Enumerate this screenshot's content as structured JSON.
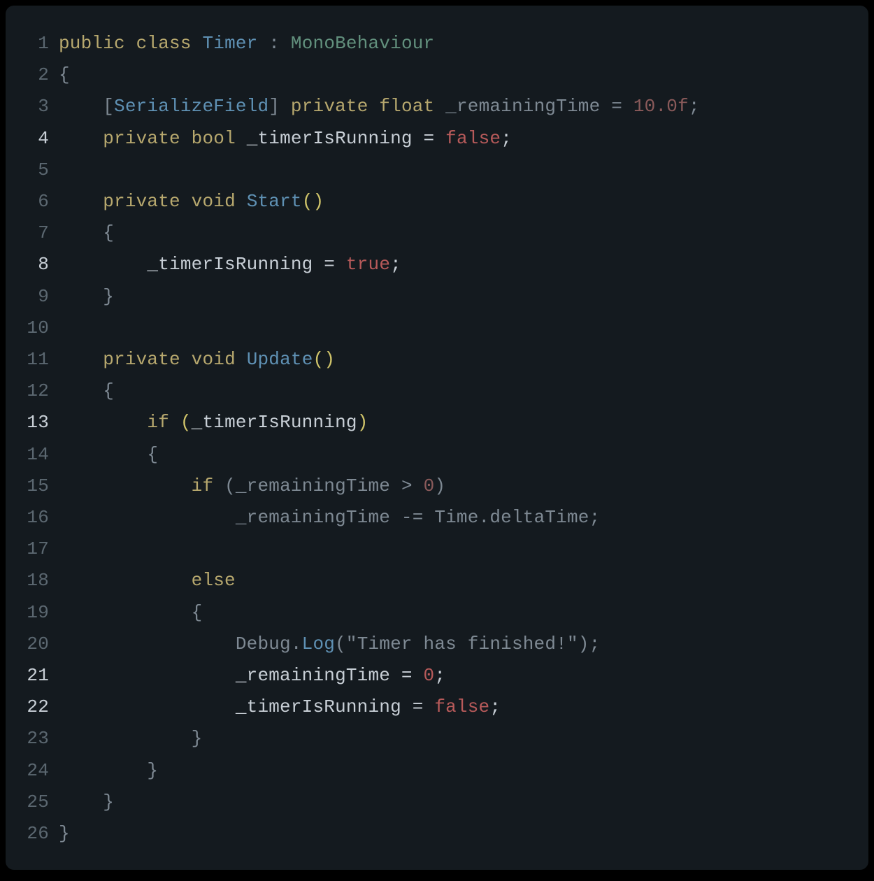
{
  "editor": {
    "lines": [
      {
        "num": "1",
        "bright": false,
        "tokens": [
          {
            "t": "public",
            "c": "tok-keyword"
          },
          {
            "t": " "
          },
          {
            "t": "class",
            "c": "tok-keyword"
          },
          {
            "t": " "
          },
          {
            "t": "Timer",
            "c": "tok-type-blue"
          },
          {
            "t": " "
          },
          {
            "t": ":",
            "c": "tok-punct"
          },
          {
            "t": " "
          },
          {
            "t": "MonoBehaviour",
            "c": "tok-type-mono"
          }
        ]
      },
      {
        "num": "2",
        "bright": false,
        "tokens": [
          {
            "t": "{",
            "c": "tok-punct"
          }
        ]
      },
      {
        "num": "3",
        "bright": false,
        "tokens": [
          {
            "t": "    "
          },
          {
            "t": "[",
            "c": "tok-punct"
          },
          {
            "t": "SerializeField",
            "c": "tok-attr"
          },
          {
            "t": "]",
            "c": "tok-punct"
          },
          {
            "t": " "
          },
          {
            "t": "private",
            "c": "tok-keyword"
          },
          {
            "t": " "
          },
          {
            "t": "float",
            "c": "tok-keyword"
          },
          {
            "t": " "
          },
          {
            "t": "_remainingTime",
            "c": "tok-field-dim"
          },
          {
            "t": " "
          },
          {
            "t": "=",
            "c": "tok-eq"
          },
          {
            "t": " "
          },
          {
            "t": "10.0f",
            "c": "tok-num-dim"
          },
          {
            "t": ";",
            "c": "tok-punct"
          }
        ]
      },
      {
        "num": "4",
        "bright": true,
        "tokens": [
          {
            "t": "    "
          },
          {
            "t": "private",
            "c": "tok-keyword"
          },
          {
            "t": " "
          },
          {
            "t": "bool",
            "c": "tok-keyword"
          },
          {
            "t": " "
          },
          {
            "t": "_timerIsRunning",
            "c": "tok-field"
          },
          {
            "t": " "
          },
          {
            "t": "=",
            "c": "tok-eq-bright"
          },
          {
            "t": " "
          },
          {
            "t": "false",
            "c": "tok-bool"
          },
          {
            "t": ";",
            "c": "tok-punct-bright"
          }
        ]
      },
      {
        "num": "5",
        "bright": false,
        "tokens": []
      },
      {
        "num": "6",
        "bright": false,
        "tokens": [
          {
            "t": "    "
          },
          {
            "t": "private",
            "c": "tok-keyword"
          },
          {
            "t": " "
          },
          {
            "t": "void",
            "c": "tok-keyword"
          },
          {
            "t": " "
          },
          {
            "t": "Start",
            "c": "tok-type-blue"
          },
          {
            "t": "()",
            "c": "tok-paren-y"
          }
        ]
      },
      {
        "num": "7",
        "bright": false,
        "tokens": [
          {
            "t": "    "
          },
          {
            "t": "{",
            "c": "tok-punct"
          }
        ]
      },
      {
        "num": "8",
        "bright": true,
        "tokens": [
          {
            "t": "        "
          },
          {
            "t": "_timerIsRunning",
            "c": "tok-field"
          },
          {
            "t": " "
          },
          {
            "t": "=",
            "c": "tok-eq-bright"
          },
          {
            "t": " "
          },
          {
            "t": "true",
            "c": "tok-bool"
          },
          {
            "t": ";",
            "c": "tok-punct-bright"
          }
        ]
      },
      {
        "num": "9",
        "bright": false,
        "tokens": [
          {
            "t": "    "
          },
          {
            "t": "}",
            "c": "tok-punct"
          }
        ]
      },
      {
        "num": "10",
        "bright": false,
        "tokens": []
      },
      {
        "num": "11",
        "bright": false,
        "tokens": [
          {
            "t": "    "
          },
          {
            "t": "private",
            "c": "tok-keyword"
          },
          {
            "t": " "
          },
          {
            "t": "void",
            "c": "tok-keyword"
          },
          {
            "t": " "
          },
          {
            "t": "Update",
            "c": "tok-type-blue"
          },
          {
            "t": "()",
            "c": "tok-paren-y"
          }
        ]
      },
      {
        "num": "12",
        "bright": false,
        "tokens": [
          {
            "t": "    "
          },
          {
            "t": "{",
            "c": "tok-punct"
          }
        ]
      },
      {
        "num": "13",
        "bright": true,
        "tokens": [
          {
            "t": "        "
          },
          {
            "t": "if",
            "c": "tok-keyword"
          },
          {
            "t": " "
          },
          {
            "t": "(",
            "c": "tok-paren-y"
          },
          {
            "t": "_timerIsRunning",
            "c": "tok-field"
          },
          {
            "t": ")",
            "c": "tok-paren-y"
          }
        ]
      },
      {
        "num": "14",
        "bright": false,
        "tokens": [
          {
            "t": "        "
          },
          {
            "t": "{",
            "c": "tok-punct"
          }
        ]
      },
      {
        "num": "15",
        "bright": false,
        "tokens": [
          {
            "t": "            "
          },
          {
            "t": "if",
            "c": "tok-keyword"
          },
          {
            "t": " "
          },
          {
            "t": "(",
            "c": "tok-punct"
          },
          {
            "t": "_remainingTime",
            "c": "tok-field-dim"
          },
          {
            "t": " "
          },
          {
            "t": ">",
            "c": "tok-eq"
          },
          {
            "t": " "
          },
          {
            "t": "0",
            "c": "tok-num-dim"
          },
          {
            "t": ")",
            "c": "tok-punct"
          }
        ]
      },
      {
        "num": "16",
        "bright": false,
        "tokens": [
          {
            "t": "                "
          },
          {
            "t": "_remainingTime",
            "c": "tok-field-dim"
          },
          {
            "t": " "
          },
          {
            "t": "-=",
            "c": "tok-eq"
          },
          {
            "t": " "
          },
          {
            "t": "Time",
            "c": "tok-field-dim"
          },
          {
            "t": ".",
            "c": "tok-punct"
          },
          {
            "t": "deltaTime",
            "c": "tok-field-dim"
          },
          {
            "t": ";",
            "c": "tok-punct"
          }
        ]
      },
      {
        "num": "17",
        "bright": false,
        "tokens": []
      },
      {
        "num": "18",
        "bright": false,
        "tokens": [
          {
            "t": "            "
          },
          {
            "t": "else",
            "c": "tok-keyword"
          }
        ]
      },
      {
        "num": "19",
        "bright": false,
        "tokens": [
          {
            "t": "            "
          },
          {
            "t": "{",
            "c": "tok-punct"
          }
        ]
      },
      {
        "num": "20",
        "bright": false,
        "tokens": [
          {
            "t": "                "
          },
          {
            "t": "Debug",
            "c": "tok-field-dim"
          },
          {
            "t": ".",
            "c": "tok-punct"
          },
          {
            "t": "Log",
            "c": "tok-type-blue"
          },
          {
            "t": "(",
            "c": "tok-punct"
          },
          {
            "t": "\"Timer has finished!\"",
            "c": "tok-string"
          },
          {
            "t": ")",
            "c": "tok-punct"
          },
          {
            "t": ";",
            "c": "tok-punct"
          }
        ]
      },
      {
        "num": "21",
        "bright": true,
        "tokens": [
          {
            "t": "                "
          },
          {
            "t": "_remainingTime",
            "c": "tok-field"
          },
          {
            "t": " "
          },
          {
            "t": "=",
            "c": "tok-eq-bright"
          },
          {
            "t": " "
          },
          {
            "t": "0",
            "c": "tok-num"
          },
          {
            "t": ";",
            "c": "tok-punct-bright"
          }
        ]
      },
      {
        "num": "22",
        "bright": true,
        "tokens": [
          {
            "t": "                "
          },
          {
            "t": "_timerIsRunning",
            "c": "tok-field"
          },
          {
            "t": " "
          },
          {
            "t": "=",
            "c": "tok-eq-bright"
          },
          {
            "t": " "
          },
          {
            "t": "false",
            "c": "tok-bool"
          },
          {
            "t": ";",
            "c": "tok-punct-bright"
          }
        ]
      },
      {
        "num": "23",
        "bright": false,
        "tokens": [
          {
            "t": "            "
          },
          {
            "t": "}",
            "c": "tok-punct"
          }
        ]
      },
      {
        "num": "24",
        "bright": false,
        "tokens": [
          {
            "t": "        "
          },
          {
            "t": "}",
            "c": "tok-punct"
          }
        ]
      },
      {
        "num": "25",
        "bright": false,
        "tokens": [
          {
            "t": "    "
          },
          {
            "t": "}",
            "c": "tok-punct"
          }
        ]
      },
      {
        "num": "26",
        "bright": false,
        "tokens": [
          {
            "t": "}",
            "c": "tok-punct"
          }
        ]
      }
    ]
  }
}
